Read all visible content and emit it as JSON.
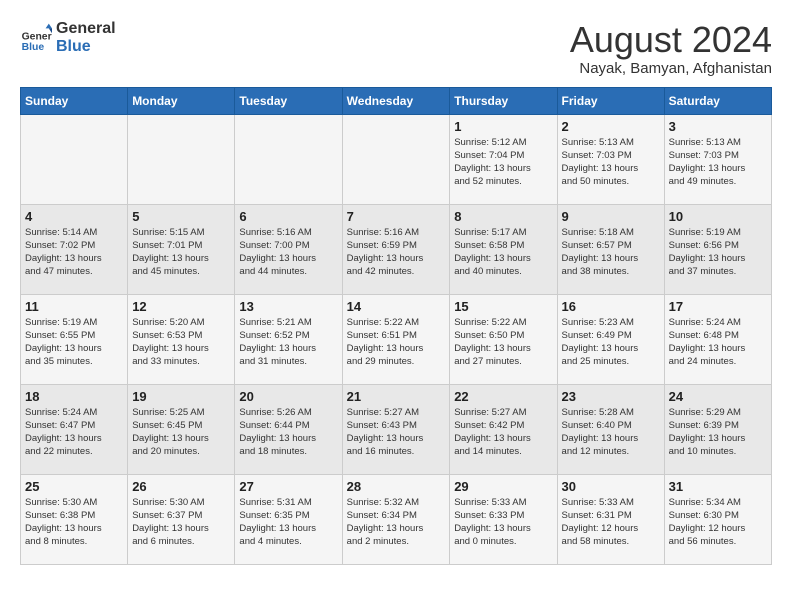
{
  "header": {
    "logo_line1": "General",
    "logo_line2": "Blue",
    "main_title": "August 2024",
    "subtitle": "Nayak, Bamyan, Afghanistan"
  },
  "days_of_week": [
    "Sunday",
    "Monday",
    "Tuesday",
    "Wednesday",
    "Thursday",
    "Friday",
    "Saturday"
  ],
  "weeks": [
    [
      {
        "day": "",
        "info": ""
      },
      {
        "day": "",
        "info": ""
      },
      {
        "day": "",
        "info": ""
      },
      {
        "day": "",
        "info": ""
      },
      {
        "day": "1",
        "info": "Sunrise: 5:12 AM\nSunset: 7:04 PM\nDaylight: 13 hours\nand 52 minutes."
      },
      {
        "day": "2",
        "info": "Sunrise: 5:13 AM\nSunset: 7:03 PM\nDaylight: 13 hours\nand 50 minutes."
      },
      {
        "day": "3",
        "info": "Sunrise: 5:13 AM\nSunset: 7:03 PM\nDaylight: 13 hours\nand 49 minutes."
      }
    ],
    [
      {
        "day": "4",
        "info": "Sunrise: 5:14 AM\nSunset: 7:02 PM\nDaylight: 13 hours\nand 47 minutes."
      },
      {
        "day": "5",
        "info": "Sunrise: 5:15 AM\nSunset: 7:01 PM\nDaylight: 13 hours\nand 45 minutes."
      },
      {
        "day": "6",
        "info": "Sunrise: 5:16 AM\nSunset: 7:00 PM\nDaylight: 13 hours\nand 44 minutes."
      },
      {
        "day": "7",
        "info": "Sunrise: 5:16 AM\nSunset: 6:59 PM\nDaylight: 13 hours\nand 42 minutes."
      },
      {
        "day": "8",
        "info": "Sunrise: 5:17 AM\nSunset: 6:58 PM\nDaylight: 13 hours\nand 40 minutes."
      },
      {
        "day": "9",
        "info": "Sunrise: 5:18 AM\nSunset: 6:57 PM\nDaylight: 13 hours\nand 38 minutes."
      },
      {
        "day": "10",
        "info": "Sunrise: 5:19 AM\nSunset: 6:56 PM\nDaylight: 13 hours\nand 37 minutes."
      }
    ],
    [
      {
        "day": "11",
        "info": "Sunrise: 5:19 AM\nSunset: 6:55 PM\nDaylight: 13 hours\nand 35 minutes."
      },
      {
        "day": "12",
        "info": "Sunrise: 5:20 AM\nSunset: 6:53 PM\nDaylight: 13 hours\nand 33 minutes."
      },
      {
        "day": "13",
        "info": "Sunrise: 5:21 AM\nSunset: 6:52 PM\nDaylight: 13 hours\nand 31 minutes."
      },
      {
        "day": "14",
        "info": "Sunrise: 5:22 AM\nSunset: 6:51 PM\nDaylight: 13 hours\nand 29 minutes."
      },
      {
        "day": "15",
        "info": "Sunrise: 5:22 AM\nSunset: 6:50 PM\nDaylight: 13 hours\nand 27 minutes."
      },
      {
        "day": "16",
        "info": "Sunrise: 5:23 AM\nSunset: 6:49 PM\nDaylight: 13 hours\nand 25 minutes."
      },
      {
        "day": "17",
        "info": "Sunrise: 5:24 AM\nSunset: 6:48 PM\nDaylight: 13 hours\nand 24 minutes."
      }
    ],
    [
      {
        "day": "18",
        "info": "Sunrise: 5:24 AM\nSunset: 6:47 PM\nDaylight: 13 hours\nand 22 minutes."
      },
      {
        "day": "19",
        "info": "Sunrise: 5:25 AM\nSunset: 6:45 PM\nDaylight: 13 hours\nand 20 minutes."
      },
      {
        "day": "20",
        "info": "Sunrise: 5:26 AM\nSunset: 6:44 PM\nDaylight: 13 hours\nand 18 minutes."
      },
      {
        "day": "21",
        "info": "Sunrise: 5:27 AM\nSunset: 6:43 PM\nDaylight: 13 hours\nand 16 minutes."
      },
      {
        "day": "22",
        "info": "Sunrise: 5:27 AM\nSunset: 6:42 PM\nDaylight: 13 hours\nand 14 minutes."
      },
      {
        "day": "23",
        "info": "Sunrise: 5:28 AM\nSunset: 6:40 PM\nDaylight: 13 hours\nand 12 minutes."
      },
      {
        "day": "24",
        "info": "Sunrise: 5:29 AM\nSunset: 6:39 PM\nDaylight: 13 hours\nand 10 minutes."
      }
    ],
    [
      {
        "day": "25",
        "info": "Sunrise: 5:30 AM\nSunset: 6:38 PM\nDaylight: 13 hours\nand 8 minutes."
      },
      {
        "day": "26",
        "info": "Sunrise: 5:30 AM\nSunset: 6:37 PM\nDaylight: 13 hours\nand 6 minutes."
      },
      {
        "day": "27",
        "info": "Sunrise: 5:31 AM\nSunset: 6:35 PM\nDaylight: 13 hours\nand 4 minutes."
      },
      {
        "day": "28",
        "info": "Sunrise: 5:32 AM\nSunset: 6:34 PM\nDaylight: 13 hours\nand 2 minutes."
      },
      {
        "day": "29",
        "info": "Sunrise: 5:33 AM\nSunset: 6:33 PM\nDaylight: 13 hours\nand 0 minutes."
      },
      {
        "day": "30",
        "info": "Sunrise: 5:33 AM\nSunset: 6:31 PM\nDaylight: 12 hours\nand 58 minutes."
      },
      {
        "day": "31",
        "info": "Sunrise: 5:34 AM\nSunset: 6:30 PM\nDaylight: 12 hours\nand 56 minutes."
      }
    ]
  ]
}
